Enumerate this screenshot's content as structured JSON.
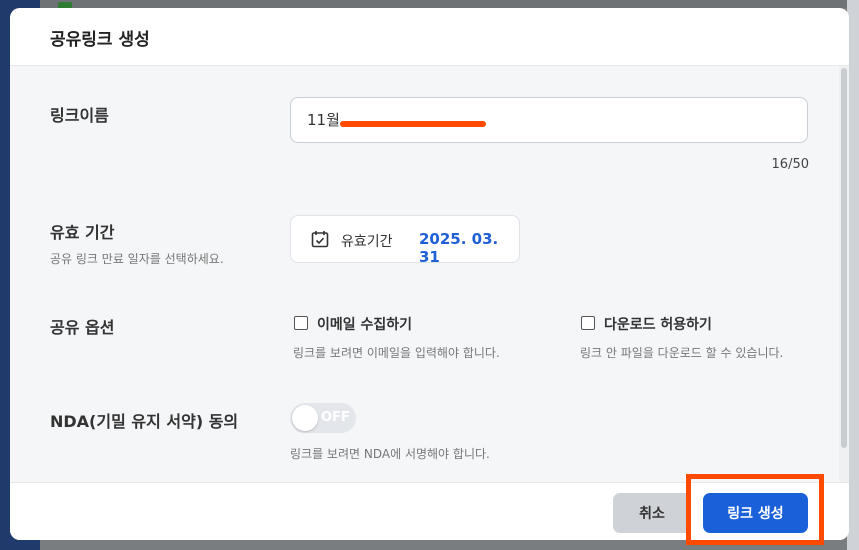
{
  "modal": {
    "title": "공유링크 생성"
  },
  "link_name": {
    "label": "링크이름",
    "value": "11월 ",
    "counter": "16/50"
  },
  "expiry": {
    "label": "유효 기간",
    "description": "공유 링크 만료 일자를 선택하세요.",
    "field_label": "유효기간",
    "date": "2025. 03. 31",
    "icon": "calendar-icon"
  },
  "share_options": {
    "label": "공유 옵션",
    "email": {
      "label": "이메일 수집하기",
      "description": "링크를 보려면 이메일을 입력해야 합니다.",
      "checked": false
    },
    "download": {
      "label": "다운로드 허용하기",
      "description": "링크 안 파일을 다운로드 할 수 있습니다.",
      "checked": false
    }
  },
  "nda": {
    "label": "NDA(기밀 유지 서약) 동의",
    "toggle_text": "OFF",
    "description": "링크를 보려면 NDA에 서명해야 합니다.",
    "enabled": false
  },
  "footer": {
    "cancel_label": "취소",
    "create_label": "링크 생성"
  },
  "colors": {
    "accent": "#1a61d9",
    "highlight": "#ff4a00"
  }
}
